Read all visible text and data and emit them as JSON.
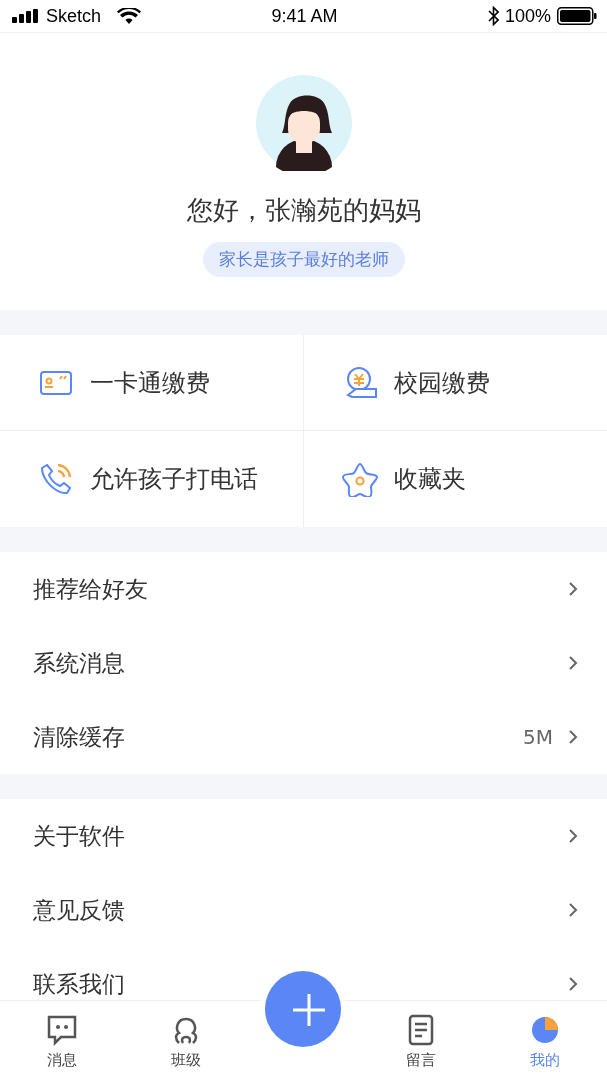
{
  "status_bar": {
    "carrier": "Sketch",
    "time": "9:41 AM",
    "battery": "100%"
  },
  "profile": {
    "greeting": "您好，张瀚苑的妈妈",
    "motto": "家长是孩子最好的老师"
  },
  "shortcuts": [
    {
      "kind": "card",
      "label": "一卡通缴费"
    },
    {
      "kind": "payment",
      "label": "校园缴费"
    },
    {
      "kind": "phone",
      "label": "允许孩子打电话"
    },
    {
      "kind": "favorite",
      "label": "收藏夹"
    }
  ],
  "menu_groups": [
    [
      {
        "label": "推荐给好友"
      },
      {
        "label": "系统消息"
      },
      {
        "label": "清除缓存",
        "value": "5M"
      }
    ],
    [
      {
        "label": "关于软件"
      },
      {
        "label": "意见反馈"
      },
      {
        "label": "联系我们"
      }
    ]
  ],
  "tab_bar": [
    {
      "kind": "message",
      "label": "消息",
      "selected": false
    },
    {
      "kind": "class",
      "label": "班级",
      "selected": false
    },
    {
      "kind": "add"
    },
    {
      "kind": "note",
      "label": "留言",
      "selected": false
    },
    {
      "kind": "me",
      "label": "我的",
      "selected": true
    }
  ]
}
